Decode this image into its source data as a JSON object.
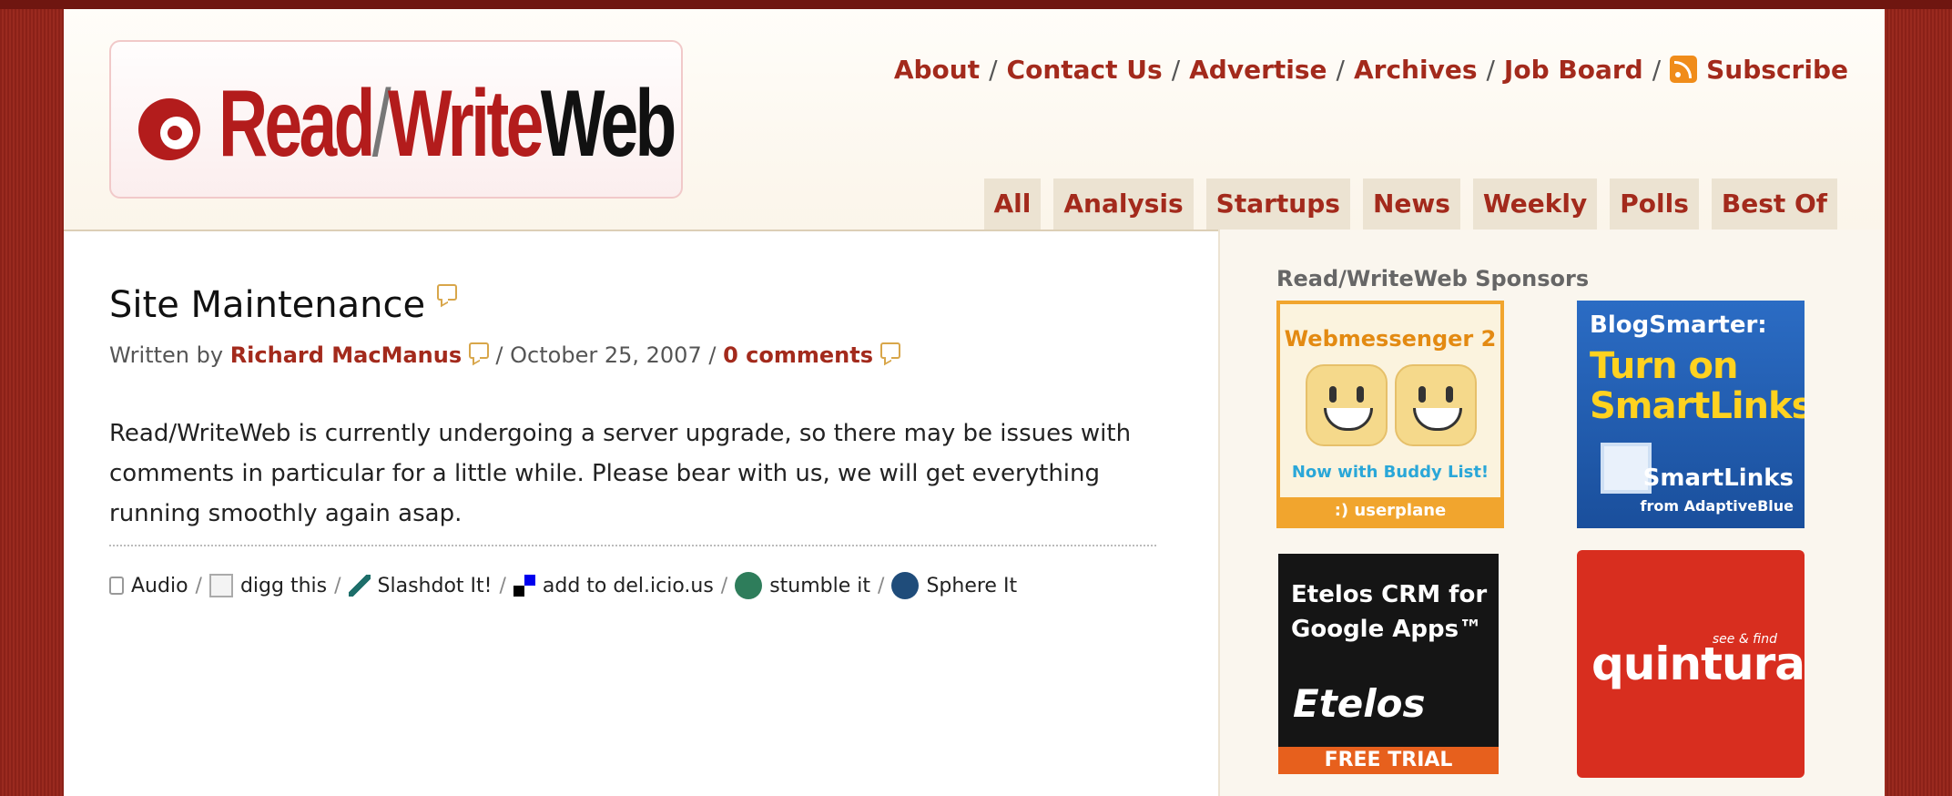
{
  "logo": {
    "rw": "Read",
    "slash": "/",
    "write": "Write",
    "web": "Web"
  },
  "nav": {
    "about": "About",
    "contact": "Contact Us",
    "advertise": "Advertise",
    "archives": "Archives",
    "jobs": "Job Board",
    "subscribe": "Subscribe",
    "sep": "/"
  },
  "tabs": [
    "All",
    "Analysis",
    "Startups",
    "News",
    "Weekly",
    "Polls",
    "Best Of"
  ],
  "post": {
    "title": "Site Maintenance",
    "written_by": "Written by",
    "author": "Richard MacManus",
    "date": "October 25, 2007",
    "comments": "0 comments",
    "body": "Read/WriteWeb is currently undergoing a server upgrade, so there may be issues with comments in particular for a little while. Please bear with us, we will get everything running smoothly again asap."
  },
  "share": {
    "audio": "Audio",
    "digg": "digg this",
    "slashdot": "Slashdot It!",
    "delicious": "add to del.icio.us",
    "stumble": "stumble it",
    "sphere": "Sphere It"
  },
  "sidebar": {
    "heading": "Read/WriteWeb Sponsors",
    "ad1": {
      "title": "Webmessenger 2",
      "subtitle": "Now with Buddy List!",
      "footer": ":) userplane"
    },
    "ad2": {
      "line1": "BlogSmarter:",
      "line2": "Turn on",
      "line3": "SmartLinks",
      "brand": "SmartLinks",
      "from": "from AdaptiveBlue"
    },
    "ad3": {
      "line1": "Etelos CRM for",
      "line2": "Google Apps™",
      "logo": "Etelos",
      "footer": "FREE TRIAL"
    },
    "ad4": {
      "logo": "quintura",
      "tag": "see & find"
    }
  },
  "colors": {
    "accent": "#a32a1c",
    "frame": "#8e2219",
    "tab_bg": "#ece3d2"
  }
}
